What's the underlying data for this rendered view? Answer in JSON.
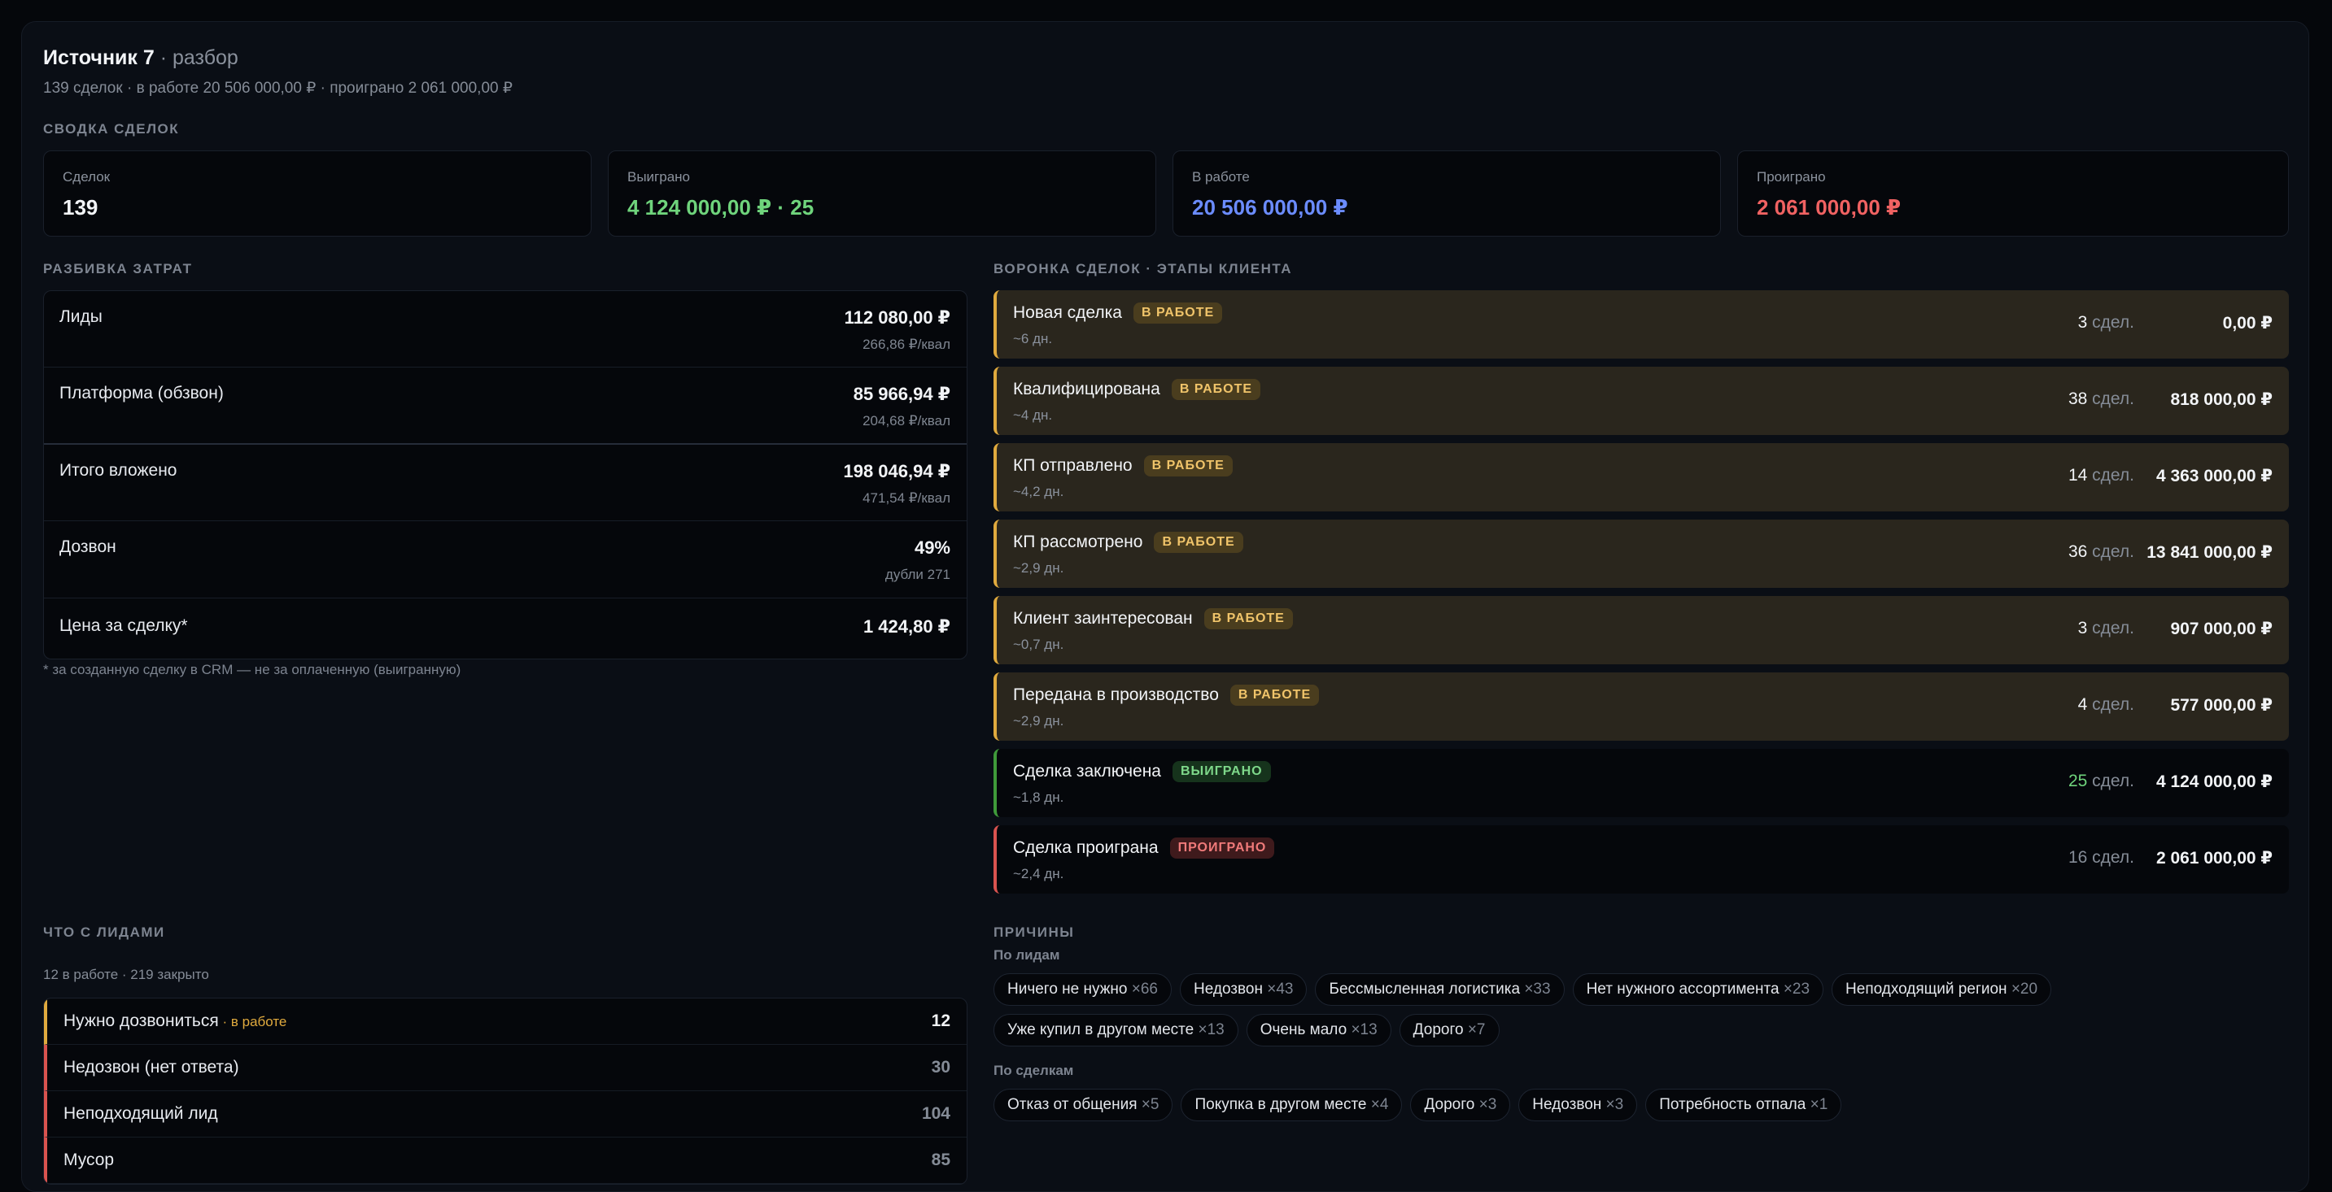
{
  "header": {
    "title": "Источник 7",
    "title_suffix": " · разбор",
    "subtitle": "139 сделок · в работе 20 506 000,00 ₽ · проиграно 2 061 000,00 ₽"
  },
  "summary": {
    "label": "СВОДКА СДЕЛОК",
    "cards": [
      {
        "label": "Сделок",
        "value": "139",
        "color": "#f2f4f7"
      },
      {
        "label": "Выиграно",
        "value": "4 124 000,00 ₽ · 25",
        "color": "#6fd47c"
      },
      {
        "label": "В работе",
        "value": "20 506 000,00 ₽",
        "color": "#6b8cff"
      },
      {
        "label": "Проиграно",
        "value": "2 061 000,00 ₽",
        "color": "#f06262"
      }
    ]
  },
  "costs": {
    "label": "РАЗБИВКА ЗАТРАТ",
    "rows": [
      {
        "name": "Лиды",
        "value": "112 080,00 ₽",
        "sub": "266,86 ₽/квал"
      },
      {
        "name": "Платформа (обзвон)",
        "value": "85 966,94 ₽",
        "sub": "204,68 ₽/квал"
      },
      {
        "name": "Итого вложено",
        "value": "198 046,94 ₽",
        "sub": "471,54 ₽/квал"
      },
      {
        "name": "Дозвон",
        "value": "49%",
        "sub": "дубли 271"
      },
      {
        "name": "Цена за сделку*",
        "value": "1 424,80 ₽",
        "sub": ""
      }
    ],
    "footnote": "* за созданную сделку в CRM — не за оплаченную (выигранную)"
  },
  "funnel": {
    "label": "ВОРОНКА СДЕЛОК · ЭТАПЫ КЛИЕНТА",
    "count_unit": "сдел.",
    "stages": [
      {
        "name": "Новая сделка",
        "badge": "В РАБОТЕ",
        "kind": "work",
        "duration": "~6 дн.",
        "count": "3",
        "amount": "0,00 ₽"
      },
      {
        "name": "Квалифицирована",
        "badge": "В РАБОТЕ",
        "kind": "work",
        "duration": "~4 дн.",
        "count": "38",
        "amount": "818 000,00 ₽"
      },
      {
        "name": "КП отправлено",
        "badge": "В РАБОТЕ",
        "kind": "work",
        "duration": "~4,2 дн.",
        "count": "14",
        "amount": "4 363 000,00 ₽"
      },
      {
        "name": "КП рассмотрено",
        "badge": "В РАБОТЕ",
        "kind": "work",
        "duration": "~2,9 дн.",
        "count": "36",
        "amount": "13 841 000,00 ₽"
      },
      {
        "name": "Клиент заинтересован",
        "badge": "В РАБОТЕ",
        "kind": "work",
        "duration": "~0,7 дн.",
        "count": "3",
        "amount": "907 000,00 ₽"
      },
      {
        "name": "Передана в производство",
        "badge": "В РАБОТЕ",
        "kind": "work",
        "duration": "~2,9 дн.",
        "count": "4",
        "amount": "577 000,00 ₽"
      },
      {
        "name": "Сделка заключена",
        "badge": "ВЫИГРАНО",
        "kind": "won",
        "duration": "~1,8 дн.",
        "count": "25",
        "amount": "4 124 000,00 ₽",
        "count_color": "#6fd47c"
      },
      {
        "name": "Сделка проиграна",
        "badge": "ПРОИГРАНО",
        "kind": "lost",
        "duration": "~2,4 дн.",
        "count": "16",
        "amount": "2 061 000,00 ₽",
        "count_color": "#858c97"
      }
    ]
  },
  "leads": {
    "label": "ЧТО С ЛИДАМИ",
    "subtitle": "12 в работе · 219 закрыто",
    "rows": [
      {
        "name": "Нужно дозвониться",
        "tag": " · в работе",
        "value": "12",
        "kind": "work"
      },
      {
        "name": "Недозвон (нет ответа)",
        "tag": "",
        "value": "30",
        "kind": "closed"
      },
      {
        "name": "Неподходящий лид",
        "tag": "",
        "value": "104",
        "kind": "closed"
      },
      {
        "name": "Мусор",
        "tag": "",
        "value": "85",
        "kind": "closed"
      }
    ]
  },
  "reasons": {
    "label": "ПРИЧИНЫ",
    "by_leads_label": "По лидам",
    "by_leads": [
      {
        "name": "Ничего не нужно",
        "count": "×66"
      },
      {
        "name": "Недозвон",
        "count": "×43"
      },
      {
        "name": "Бессмысленная логистика",
        "count": "×33"
      },
      {
        "name": "Нет нужного ассортимента",
        "count": "×23"
      },
      {
        "name": "Неподходящий регион",
        "count": "×20"
      },
      {
        "name": "Уже купил в другом месте",
        "count": "×13"
      },
      {
        "name": "Очень мало",
        "count": "×13"
      },
      {
        "name": "Дорого",
        "count": "×7"
      }
    ],
    "by_deals_label": "По сделкам",
    "by_deals": [
      {
        "name": "Отказ от общения",
        "count": "×5"
      },
      {
        "name": "Покупка в другом месте",
        "count": "×4"
      },
      {
        "name": "Дорого",
        "count": "×3"
      },
      {
        "name": "Недозвон",
        "count": "×3"
      },
      {
        "name": "Потребность отпала",
        "count": "×1"
      }
    ]
  }
}
